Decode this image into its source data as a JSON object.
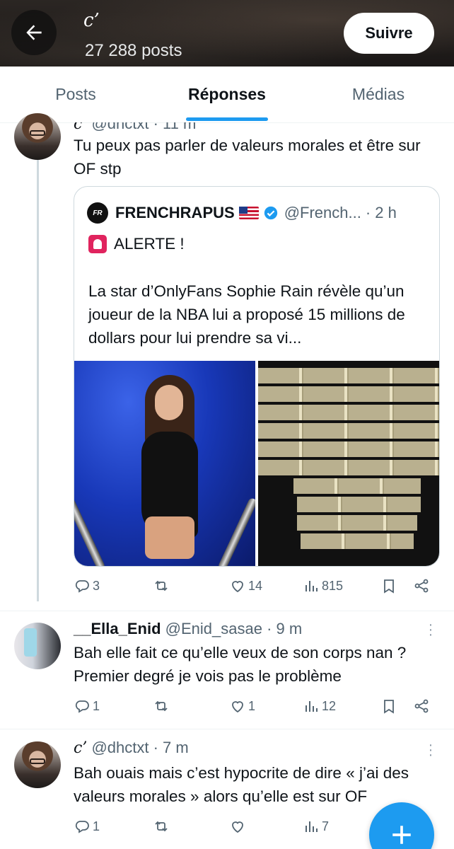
{
  "header": {
    "name": "c’",
    "post_count": "27 288 posts",
    "follow_label": "Suivre"
  },
  "tabs": [
    {
      "label": "Posts",
      "active": false
    },
    {
      "label": "Réponses",
      "active": true
    },
    {
      "label": "Médias",
      "active": false
    }
  ],
  "tweets": [
    {
      "name": "c’",
      "handle": "@dhctxt",
      "time": "· 11 m",
      "text": "Tu peux pas parler de valeurs morales et être sur OF stp",
      "quote": {
        "name": "FRENCHRAPUS",
        "handle": "@French...",
        "time": "· 2 h",
        "line1": "ALERTE !",
        "text": "La star d’OnlyFans Sophie Rain révèle qu’un joueur de la NBA lui a proposé 15 millions de dollars pour lui prendre sa vi..."
      },
      "stats": {
        "replies": "3",
        "retweets": "",
        "likes": "14",
        "views": "815"
      }
    },
    {
      "name": "__Ella_Enid",
      "handle": "@Enid_sasae",
      "time": "· 9 m",
      "text": "Bah elle fait ce qu’elle veux de son corps nan ? Premier degré je vois pas le problème",
      "stats": {
        "replies": "1",
        "retweets": "",
        "likes": "1",
        "views": "12"
      }
    },
    {
      "name": "c’",
      "handle": "@dhctxt",
      "time": "· 7 m",
      "text": "Bah ouais mais c’est hypocrite de dire « j’ai des valeurs morales » alors qu’elle est sur OF",
      "stats": {
        "replies": "1",
        "retweets": "",
        "likes": "",
        "views": "7"
      }
    }
  ],
  "colors": {
    "accent": "#1d9bf0",
    "text": "#0f1419",
    "muted": "#536471"
  }
}
